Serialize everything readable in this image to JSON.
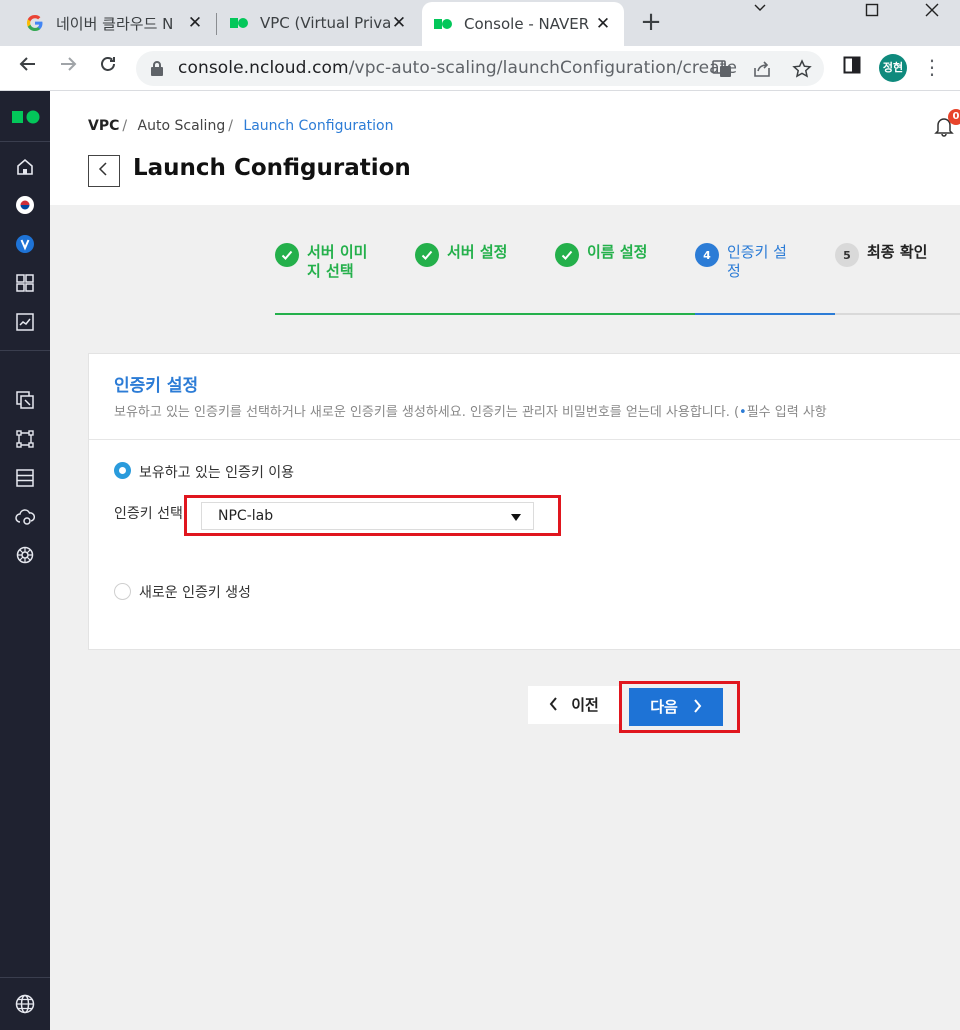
{
  "browser": {
    "tabs": [
      {
        "title": "네이버 클라우드 N",
        "favicon": "google-icon"
      },
      {
        "title": "VPC (Virtual Privat",
        "favicon": "ncloud-icon"
      },
      {
        "title": "Console - NAVER",
        "favicon": "ncloud-icon",
        "active": true
      }
    ],
    "url_host": "console.ncloud.com",
    "url_path": "/vpc-auto-scaling/launchConfiguration/create",
    "profile_initials": "정현"
  },
  "breadcrumb": {
    "root": "VPC",
    "mid": "Auto Scaling",
    "current": "Launch Configuration"
  },
  "page": {
    "title": "Launch Configuration",
    "notification_count": "0"
  },
  "steps": [
    {
      "num": "1",
      "label": "서버 이미지 선택",
      "status": "done"
    },
    {
      "num": "2",
      "label": "서버 설정",
      "status": "done"
    },
    {
      "num": "3",
      "label": "이름 설정",
      "status": "done"
    },
    {
      "num": "4",
      "label": "인증키 설정",
      "status": "current"
    },
    {
      "num": "5",
      "label": "최종 확인",
      "status": "todo"
    }
  ],
  "card": {
    "title": "인증키 설정",
    "description": "보유하고 있는 인증키를 선택하거나 새로운 인증키를 생성하세요. 인증키는 관리자 비밀번호를 얻는데 사용합니다. (",
    "required_note": "필수 입력 사항",
    "option_existing": "보유하고 있는 인증키 이용",
    "field_label": "인증키 선택",
    "selected_key": "NPC-lab",
    "option_new": "새로운 인증키 생성"
  },
  "buttons": {
    "prev": "이전",
    "next": "다음"
  },
  "colors": {
    "primary": "#2c7cd6",
    "done_green": "#24b04b",
    "highlight_red": "#e0161e",
    "rail_bg": "#1f2230"
  }
}
